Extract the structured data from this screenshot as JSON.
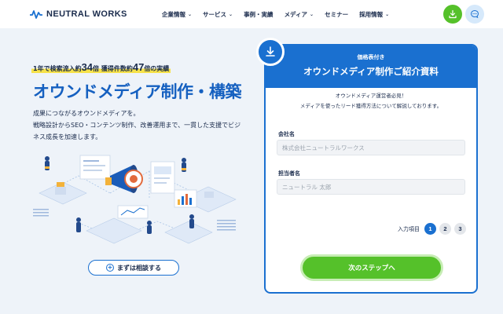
{
  "header": {
    "brand": "NEUTRAL WORKS",
    "nav": [
      {
        "label": "企業情報",
        "dropdown": true
      },
      {
        "label": "サービス",
        "dropdown": true
      },
      {
        "label": "事例・実績",
        "dropdown": false
      },
      {
        "label": "メディア",
        "dropdown": true
      },
      {
        "label": "セミナー",
        "dropdown": false
      },
      {
        "label": "採用情報",
        "dropdown": true
      }
    ],
    "download_icon": "download-icon",
    "chat_icon": "chat-icon",
    "colors": {
      "green": "#55c12a",
      "light_blue": "#d6e9fb"
    }
  },
  "hero": {
    "badge": {
      "p1": "1年で検索流入約",
      "n1": "34",
      "p2": "倍 獲得件数約",
      "n2": "47",
      "p3": "倍の実績"
    },
    "title": "オウンドメディア制作・構築",
    "desc": [
      "成果につながるオウンドメディアを。",
      "戦略設計からSEO・コンテンツ制作、改善運用まで、一貫した支援でビジ",
      "ネス成長を加速します。"
    ],
    "consult_button": "まずは相談する",
    "accent": "#1560c0"
  },
  "form": {
    "kicker": "価格表付き",
    "title": "オウンドメディア制作ご紹介資料",
    "intro": [
      "オウンドメディア運営者必見！",
      "メディアを使ったリード獲得方法について解説しております。"
    ],
    "company_label": "会社名",
    "company_placeholder": "株式会社ニュートラルワークス",
    "person_label": "担当者名",
    "person_placeholder": "ニュートラル 太郎",
    "steps_label": "入力項目",
    "steps": [
      "1",
      "2",
      "3"
    ],
    "current_step": 1,
    "next_button": "次のステップへ",
    "colors": {
      "primary": "#1a70d0",
      "cta": "#55c12a"
    }
  }
}
